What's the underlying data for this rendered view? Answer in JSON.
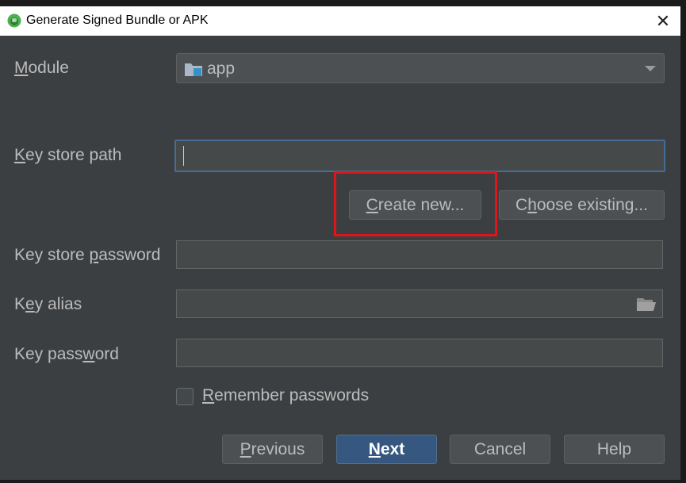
{
  "window": {
    "title": "Generate Signed Bundle or APK"
  },
  "module": {
    "label": "Module",
    "value": "app"
  },
  "keystore": {
    "path_label": "Key store path",
    "path_value": "",
    "create_new": "Create new...",
    "choose_existing": "Choose existing...",
    "password_label": "Key store password",
    "password_value": ""
  },
  "key": {
    "alias_label": "Key alias",
    "alias_value": "",
    "password_label": "Key password",
    "password_value": ""
  },
  "remember": {
    "label": "Remember passwords",
    "checked": false
  },
  "buttons": {
    "previous": "Previous",
    "next": "Next",
    "cancel": "Cancel",
    "help": "Help"
  },
  "colors": {
    "background": "#3c3f41",
    "primary": "#365880",
    "focus": "#466d94",
    "highlight": "#e2141a"
  }
}
